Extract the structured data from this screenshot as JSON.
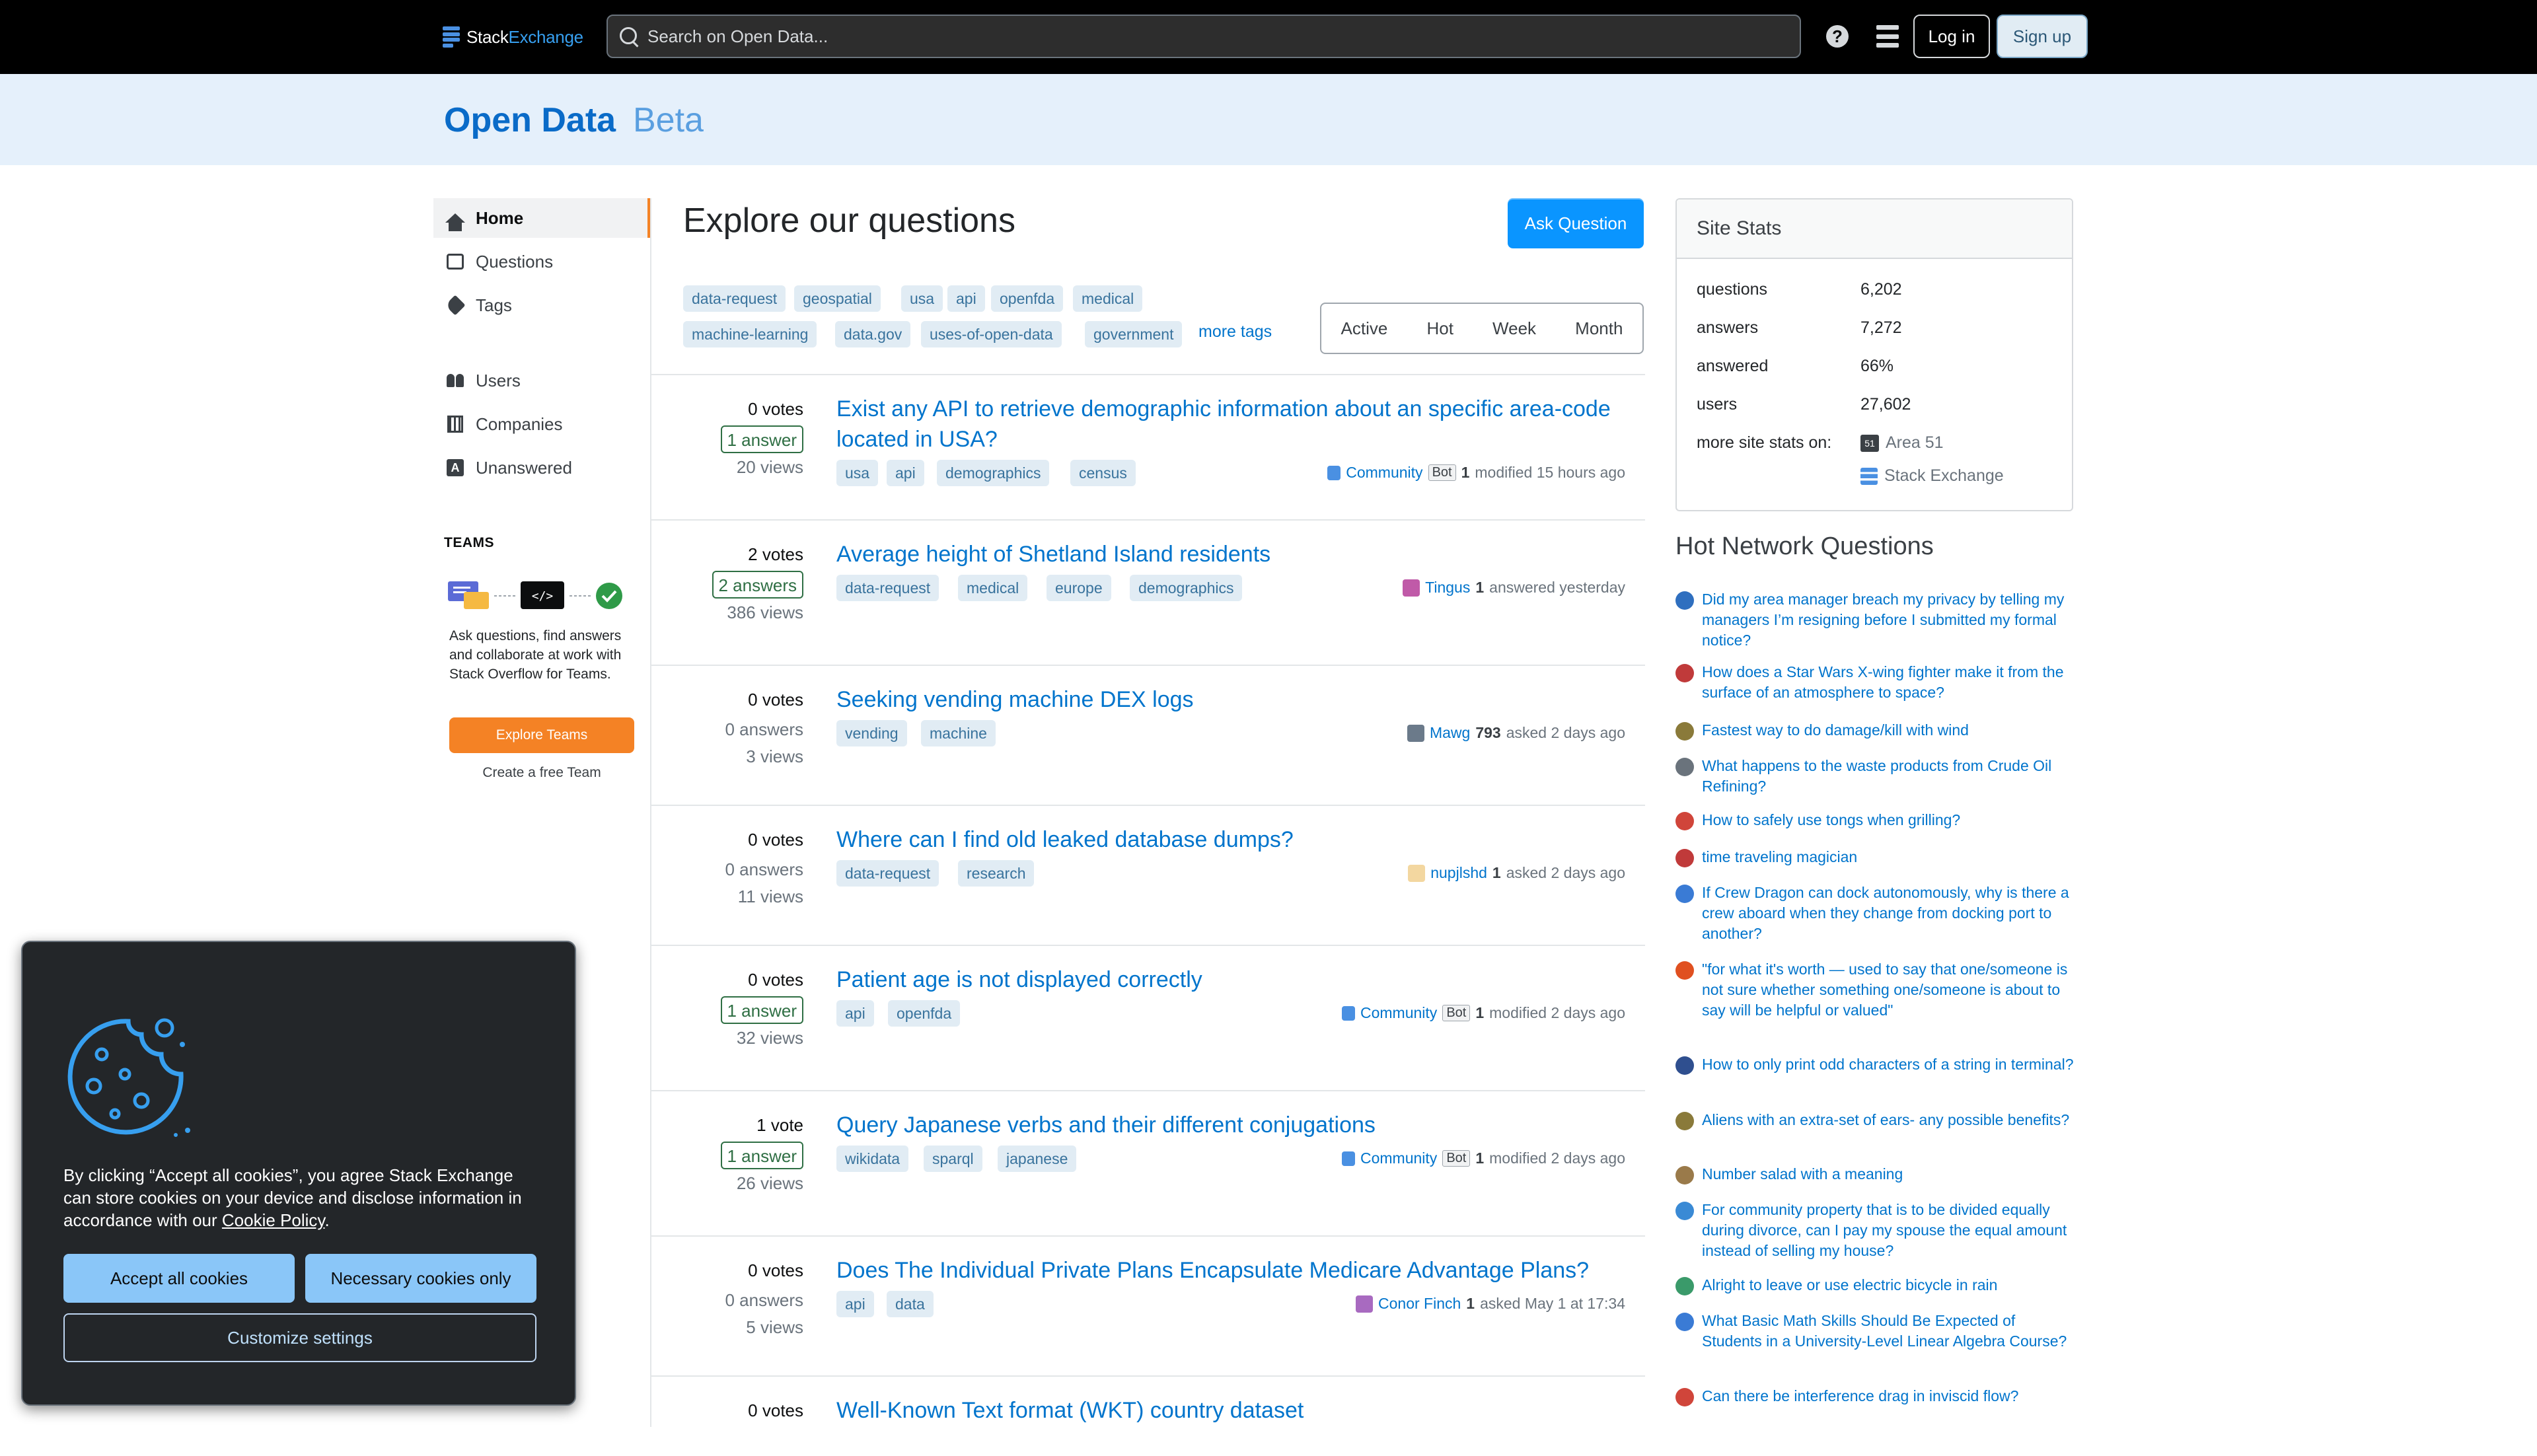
{
  "topbar": {
    "logo_text": "Stack",
    "logo_text_accent": "Exchange",
    "search_placeholder": "Search on Open Data...",
    "help_icon": "?",
    "login_label": "Log in",
    "signup_label": "Sign up"
  },
  "site": {
    "title": "Open Data",
    "beta": "Beta"
  },
  "nav": {
    "items": [
      {
        "label": "Home",
        "icon": "home-icon"
      },
      {
        "label": "Questions",
        "icon": "questions-icon"
      },
      {
        "label": "Tags",
        "icon": "tag-icon"
      },
      {
        "label": "Users",
        "icon": "users-icon"
      },
      {
        "label": "Companies",
        "icon": "companies-icon"
      },
      {
        "label": "Unanswered",
        "icon": "unanswered-icon"
      }
    ],
    "teams_label": "TEAMS",
    "teams_text": "Ask questions, find answers and collaborate at work with Stack Overflow for Teams.",
    "explore_label": "Explore Teams",
    "create_label": "Create a free Team"
  },
  "main": {
    "title": "Explore our questions",
    "ask_label": "Ask Question",
    "popular_tags": [
      "data-request",
      "geospatial",
      "usa",
      "api",
      "openfda",
      "medical",
      "machine-learning",
      "data.gov",
      "uses-of-open-data",
      "government"
    ],
    "more_tags": "more tags",
    "filters": [
      "Active",
      "Hot",
      "Week",
      "Month"
    ]
  },
  "questions": [
    {
      "votes": "0 votes",
      "answers": "1 answer",
      "answered": true,
      "views": "20 views",
      "title": "Exist any API to retrieve demographic information about an specific area-code located in USA?",
      "tags": [
        "usa",
        "api",
        "demographics",
        "census"
      ],
      "user": "Community",
      "bot": "Bot",
      "rep": "1",
      "action": "modified 15 hours ago"
    },
    {
      "votes": "2 votes",
      "answers": "2 answers",
      "answered": true,
      "views": "386 views",
      "title": "Average height of Shetland Island residents",
      "tags": [
        "data-request",
        "medical",
        "europe",
        "demographics"
      ],
      "user": "Tingus",
      "bot": "",
      "rep": "1",
      "action": "answered yesterday"
    },
    {
      "votes": "0 votes",
      "answers": "0 answers",
      "answered": false,
      "views": "3 views",
      "title": "Seeking vending machine DEX logs",
      "tags": [
        "vending",
        "machine"
      ],
      "user": "Mawg",
      "bot": "",
      "rep": "793",
      "action": "asked 2 days ago"
    },
    {
      "votes": "0 votes",
      "answers": "0 answers",
      "answered": false,
      "views": "11 views",
      "title": "Where can I find old leaked database dumps?",
      "tags": [
        "data-request",
        "research"
      ],
      "user": "nupjlshd",
      "bot": "",
      "rep": "1",
      "action": "asked 2 days ago"
    },
    {
      "votes": "0 votes",
      "answers": "1 answer",
      "answered": true,
      "views": "32 views",
      "title": "Patient age is not displayed correctly",
      "tags": [
        "api",
        "openfda"
      ],
      "user": "Community",
      "bot": "Bot",
      "rep": "1",
      "action": "modified 2 days ago"
    },
    {
      "votes": "1 vote",
      "answers": "1 answer",
      "answered": true,
      "views": "26 views",
      "title": "Query Japanese verbs and their different conjugations",
      "tags": [
        "wikidata",
        "sparql",
        "japanese"
      ],
      "user": "Community",
      "bot": "Bot",
      "rep": "1",
      "action": "modified 2 days ago"
    },
    {
      "votes": "0 votes",
      "answers": "0 answers",
      "answered": false,
      "views": "5 views",
      "title": "Does The Individual Private Plans Encapsulate Medicare Advantage Plans?",
      "tags": [
        "api",
        "data"
      ],
      "user": "Conor Finch",
      "bot": "",
      "rep": "1",
      "action": "asked May 1 at 17:34"
    },
    {
      "votes": "0 votes",
      "answers": "",
      "answered": false,
      "views": "",
      "title": "Well-Known Text format (WKT) country dataset",
      "tags": [],
      "user": "",
      "bot": "",
      "rep": "",
      "action": ""
    }
  ],
  "site_stats": {
    "title": "Site Stats",
    "rows": [
      {
        "label": "questions",
        "value": "6,202"
      },
      {
        "label": "answers",
        "value": "7,272"
      },
      {
        "label": "answered",
        "value": "66%"
      },
      {
        "label": "users",
        "value": "27,602"
      }
    ],
    "more_label": "more site stats on:",
    "links": [
      "Area 51",
      "Stack Exchange"
    ]
  },
  "hot_network": {
    "title": "Hot Network Questions",
    "items": [
      {
        "text": "Did my area manager breach my privacy by telling my managers I’m resigning before I submitted my formal notice?",
        "color": "#2f6fbf"
      },
      {
        "text": "How does a Star Wars X-wing fighter make it from the surface of an atmosphere to space?",
        "color": "#c03a3a"
      },
      {
        "text": "Fastest way to do damage/kill with wind",
        "color": "#8a7a3a"
      },
      {
        "text": "What happens to the waste products from Crude Oil Refining?",
        "color": "#6a737c"
      },
      {
        "text": "How to safely use tongs when grilling?",
        "color": "#d0453a"
      },
      {
        "text": "time traveling magician",
        "color": "#c03a3a"
      },
      {
        "text": "If Crew Dragon can dock autonomously, why is there a crew aboard when they change from docking port to another?",
        "color": "#3a7bd5"
      },
      {
        "text": "\"for what it's worth — used to say that one/someone is not sure whether something one/someone is about to say will be helpful or valued\"",
        "color": "#e05020"
      },
      {
        "text": "How to only print odd characters of a string in terminal?",
        "color": "#2f4f8f"
      },
      {
        "text": "Aliens with an extra-set of ears- any possible benefits?",
        "color": "#8a7a3a"
      },
      {
        "text": "Number salad with a meaning",
        "color": "#9a7a4a"
      },
      {
        "text": "For community property that is to be divided equally during divorce, can I pay my spouse the equal amount instead of selling my house?",
        "color": "#3a8ad5"
      },
      {
        "text": "Alright to leave or use electric bicycle in rain",
        "color": "#3a9a6a"
      },
      {
        "text": "What Basic Math Skills Should Be Expected of Students in a University-Level Linear Algebra Course?",
        "color": "#3a7bd5"
      },
      {
        "text": "Can there be interference drag in inviscid flow?",
        "color": "#d0453a"
      }
    ]
  },
  "cookie": {
    "text_before": "By clicking “Accept all cookies”, you agree Stack Exchange can store cookies on your device and disclose information in accordance with our ",
    "policy_link": "Cookie Policy",
    "text_after": ".",
    "accept_label": "Accept all cookies",
    "necessary_label": "Necessary cookies only",
    "customize_label": "Customize settings"
  }
}
